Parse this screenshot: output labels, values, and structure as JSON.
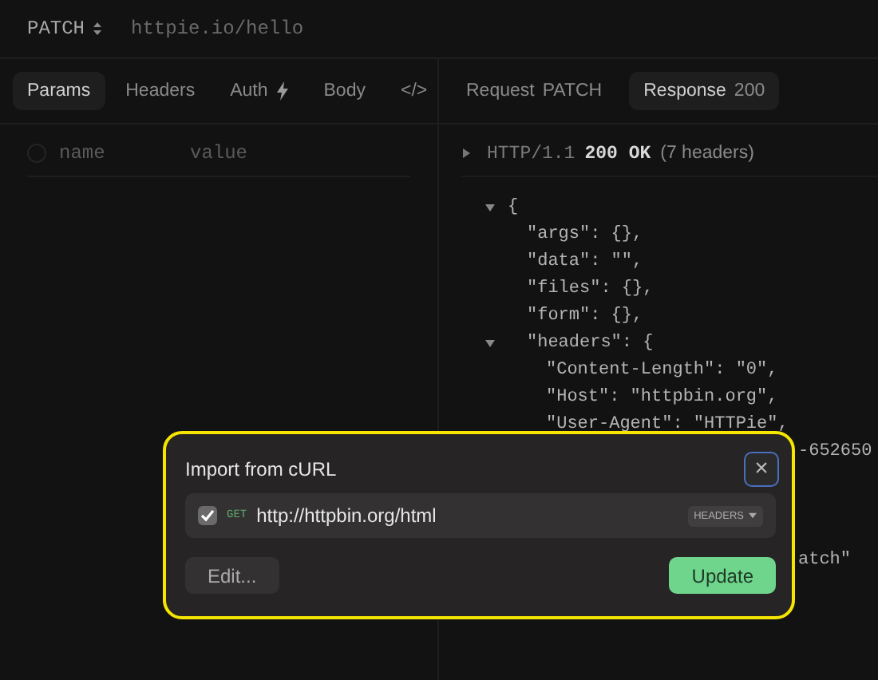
{
  "request": {
    "method": "PATCH",
    "url": "httpie.io/hello"
  },
  "request_tabs": [
    {
      "label": "Params",
      "selected": true,
      "kind": "text"
    },
    {
      "label": "Headers",
      "selected": false,
      "kind": "text"
    },
    {
      "label": "Auth",
      "selected": false,
      "kind": "bolt"
    },
    {
      "label": "Body",
      "selected": false,
      "kind": "text"
    },
    {
      "label": "</>",
      "selected": false,
      "kind": "text"
    }
  ],
  "params": {
    "checked": false,
    "columns": [
      "name",
      "value"
    ]
  },
  "response_tabs": [
    {
      "label": "Request",
      "detail": "PATCH",
      "selected": false
    },
    {
      "label": "Response",
      "detail": "200",
      "selected": true
    }
  ],
  "status_line": {
    "expanded": false,
    "protocol": "HTTP/1.1",
    "code": "200 OK",
    "note": "(7 headers)"
  },
  "body": {
    "text": "{",
    "expanded": true,
    "children": [
      {
        "text": "\"args\": {},"
      },
      {
        "text": "\"data\": \"\","
      },
      {
        "text": "\"files\": {},"
      },
      {
        "text": "\"form\": {},"
      },
      {
        "text": "\"headers\": {",
        "expanded": true,
        "children": [
          {
            "text": "\"Content-Length\": \"0\","
          },
          {
            "text": "\"Host\": \"httpbin.org\","
          },
          {
            "text": "\"User-Agent\": \"HTTPie\","
          },
          {
            "text": "-652650",
            "kind": "obscured"
          }
        ]
      },
      {
        "text": "atch\"",
        "kind": "obscured",
        "gap": true
      }
    ]
  },
  "dialog": {
    "title": "Import from cURL",
    "close": "×",
    "requests": [
      {
        "checked": true,
        "method": "GET",
        "url": "http://httpbin.org/html",
        "menu": "HEADERS"
      }
    ],
    "buttons": [
      {
        "label": "Edit...",
        "kind": "secondary"
      },
      {
        "label": "Update",
        "kind": "primary"
      }
    ]
  }
}
